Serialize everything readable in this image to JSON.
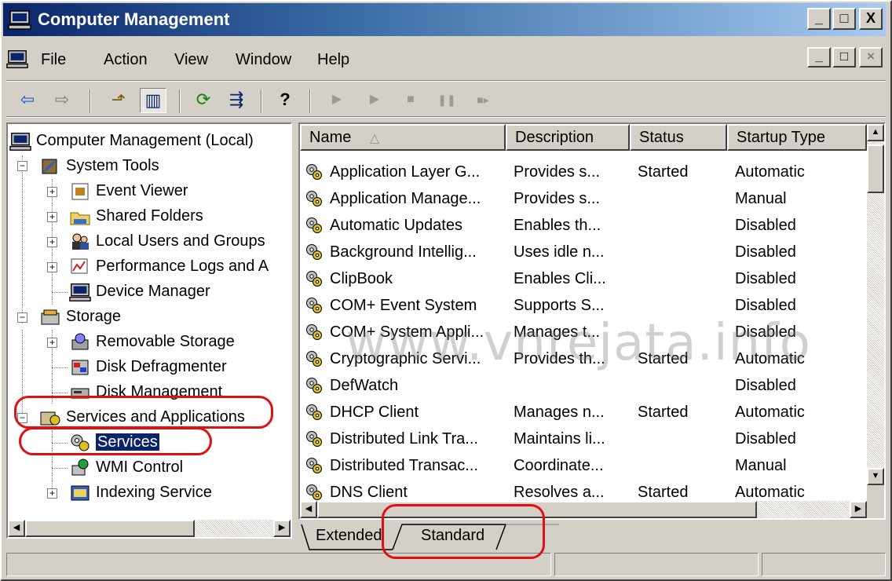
{
  "window": {
    "title": "Computer Management",
    "caption_buttons": [
      "_",
      "□",
      "X"
    ]
  },
  "menubar": {
    "items": [
      {
        "label": "File"
      },
      {
        "label": "Action"
      },
      {
        "label": "View"
      },
      {
        "label": "Window"
      },
      {
        "label": "Help"
      }
    ],
    "mdi_buttons": [
      "_",
      "□",
      "×"
    ]
  },
  "toolbar": {
    "buttons": [
      {
        "name": "back-icon",
        "glyph": "⇦"
      },
      {
        "name": "forward-icon",
        "glyph": "⇨"
      },
      {
        "name": "up-folder-icon",
        "glyph": "⬏"
      },
      {
        "name": "show-hide-tree-icon",
        "glyph": "▥"
      },
      {
        "name": "refresh-icon",
        "glyph": "⟳"
      },
      {
        "name": "export-list-icon",
        "glyph": "⇶"
      },
      {
        "name": "help-icon",
        "glyph": "?"
      },
      {
        "name": "start-service-icon",
        "glyph": "▶"
      },
      {
        "name": "start-service-alt-icon",
        "glyph": "▶"
      },
      {
        "name": "stop-service-icon",
        "glyph": "■"
      },
      {
        "name": "pause-service-icon",
        "glyph": "❚❚"
      },
      {
        "name": "restart-service-icon",
        "glyph": "■▸"
      }
    ]
  },
  "tree": {
    "root": "Computer Management (Local)",
    "system_tools": "System Tools",
    "event_viewer": "Event Viewer",
    "shared_folders": "Shared Folders",
    "local_users": "Local Users and Groups",
    "perf_logs": "Performance Logs and A",
    "device_manager": "Device Manager",
    "storage": "Storage",
    "removable_storage": "Removable Storage",
    "disk_defrag": "Disk Defragmenter",
    "disk_management": "Disk Management",
    "services_and_apps": "Services and Applications",
    "services": "Services",
    "wmi_control": "WMI Control",
    "indexing_service": "Indexing Service"
  },
  "list": {
    "columns": [
      "Name",
      "Description",
      "Status",
      "Startup Type"
    ],
    "sort_indicator": "△",
    "rows": [
      {
        "name": "Application Layer G...",
        "description": "Provides s...",
        "status": "Started",
        "startup": "Automatic"
      },
      {
        "name": "Application Manage...",
        "description": "Provides s...",
        "status": "",
        "startup": "Manual"
      },
      {
        "name": "Automatic Updates",
        "description": "Enables th...",
        "status": "",
        "startup": "Disabled"
      },
      {
        "name": "Background Intellig...",
        "description": "Uses idle n...",
        "status": "",
        "startup": "Disabled"
      },
      {
        "name": "ClipBook",
        "description": "Enables Cli...",
        "status": "",
        "startup": "Disabled"
      },
      {
        "name": "COM+ Event System",
        "description": "Supports S...",
        "status": "",
        "startup": "Disabled"
      },
      {
        "name": "COM+ System Appli...",
        "description": "Manages t...",
        "status": "",
        "startup": "Disabled"
      },
      {
        "name": "Cryptographic Servi...",
        "description": "Provides th...",
        "status": "Started",
        "startup": "Automatic"
      },
      {
        "name": "DefWatch",
        "description": "",
        "status": "",
        "startup": "Disabled"
      },
      {
        "name": "DHCP Client",
        "description": "Manages n...",
        "status": "Started",
        "startup": "Automatic"
      },
      {
        "name": "Distributed Link Tra...",
        "description": "Maintains li...",
        "status": "",
        "startup": "Disabled"
      },
      {
        "name": "Distributed Transac...",
        "description": "Coordinate...",
        "status": "",
        "startup": "Manual"
      },
      {
        "name": "DNS Client",
        "description": "Resolves a...",
        "status": "Started",
        "startup": "Automatic"
      }
    ]
  },
  "tabs": [
    {
      "label": "Extended"
    },
    {
      "label": "Standard",
      "active": true
    }
  ],
  "watermark": "www.vnrejata.info",
  "colors": {
    "title_gradient_start": "#0a246a",
    "selection": "#0a246a",
    "annotation_red": "#e01010"
  }
}
